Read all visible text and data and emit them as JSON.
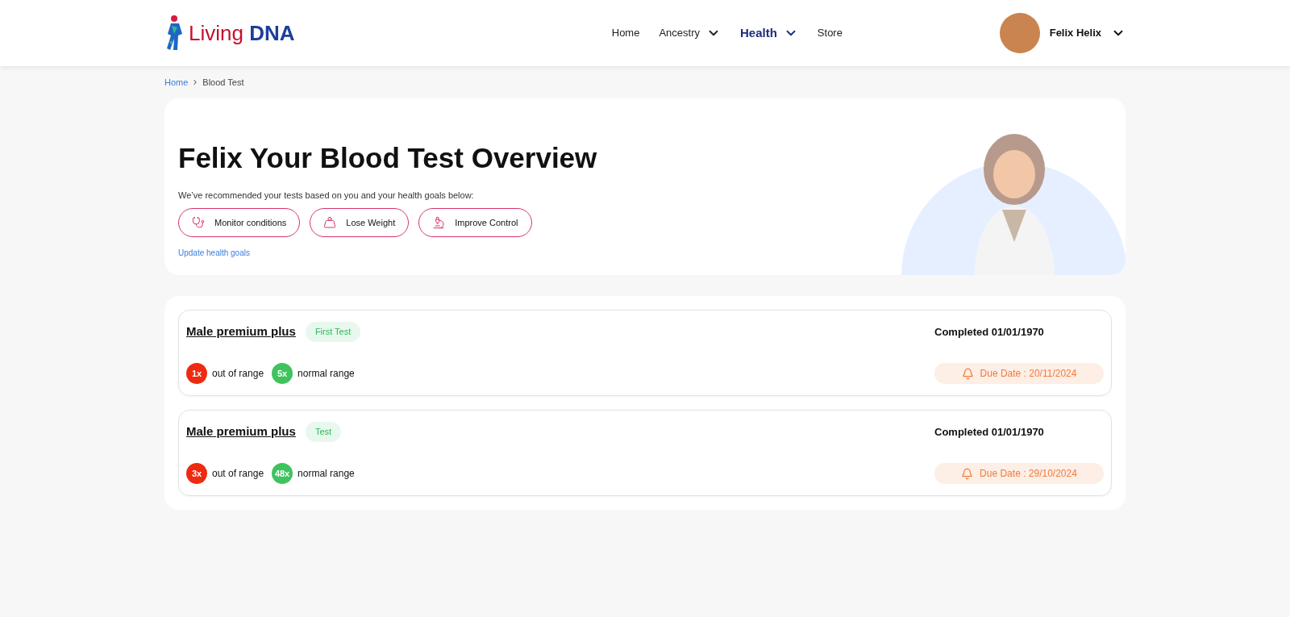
{
  "header": {
    "logo": {
      "first": "Living",
      "second": "DNA"
    },
    "nav": [
      {
        "label": "Home",
        "selected": false,
        "dropdown": false
      },
      {
        "label": "Ancestry",
        "selected": false,
        "dropdown": true
      },
      {
        "label": "Health",
        "selected": true,
        "dropdown": true
      },
      {
        "label": "Store",
        "selected": false,
        "dropdown": false
      }
    ],
    "user": {
      "name": "Felix Helix"
    }
  },
  "breadcrumb": [
    {
      "label": "Home",
      "link": true
    },
    {
      "label": "Blood Test",
      "link": false
    }
  ],
  "hero": {
    "title": "Felix Your Blood Test Overview",
    "subtitle": "We’ve recommended your tests based on you and your health goals below:",
    "goals": [
      {
        "label": "Monitor conditions"
      },
      {
        "label": "Lose Weight"
      },
      {
        "label": "Improve Control"
      }
    ],
    "link": "Update health goals"
  },
  "tests": [
    {
      "name": "Male premium plus",
      "tag": "First Test",
      "completed": "Completed 01/01/1970",
      "out_count": "1x",
      "out_label": "out of range",
      "normal_count": "5x",
      "normal_label": "normal range",
      "due": "Due Date : 20/11/2024"
    },
    {
      "name": "Male premium plus",
      "tag": "Test",
      "completed": "Completed 01/01/1970",
      "out_count": "3x",
      "out_label": "out of range",
      "normal_count": "48x",
      "normal_label": "normal range",
      "due": "Due Date : 29/10/2024"
    }
  ]
}
